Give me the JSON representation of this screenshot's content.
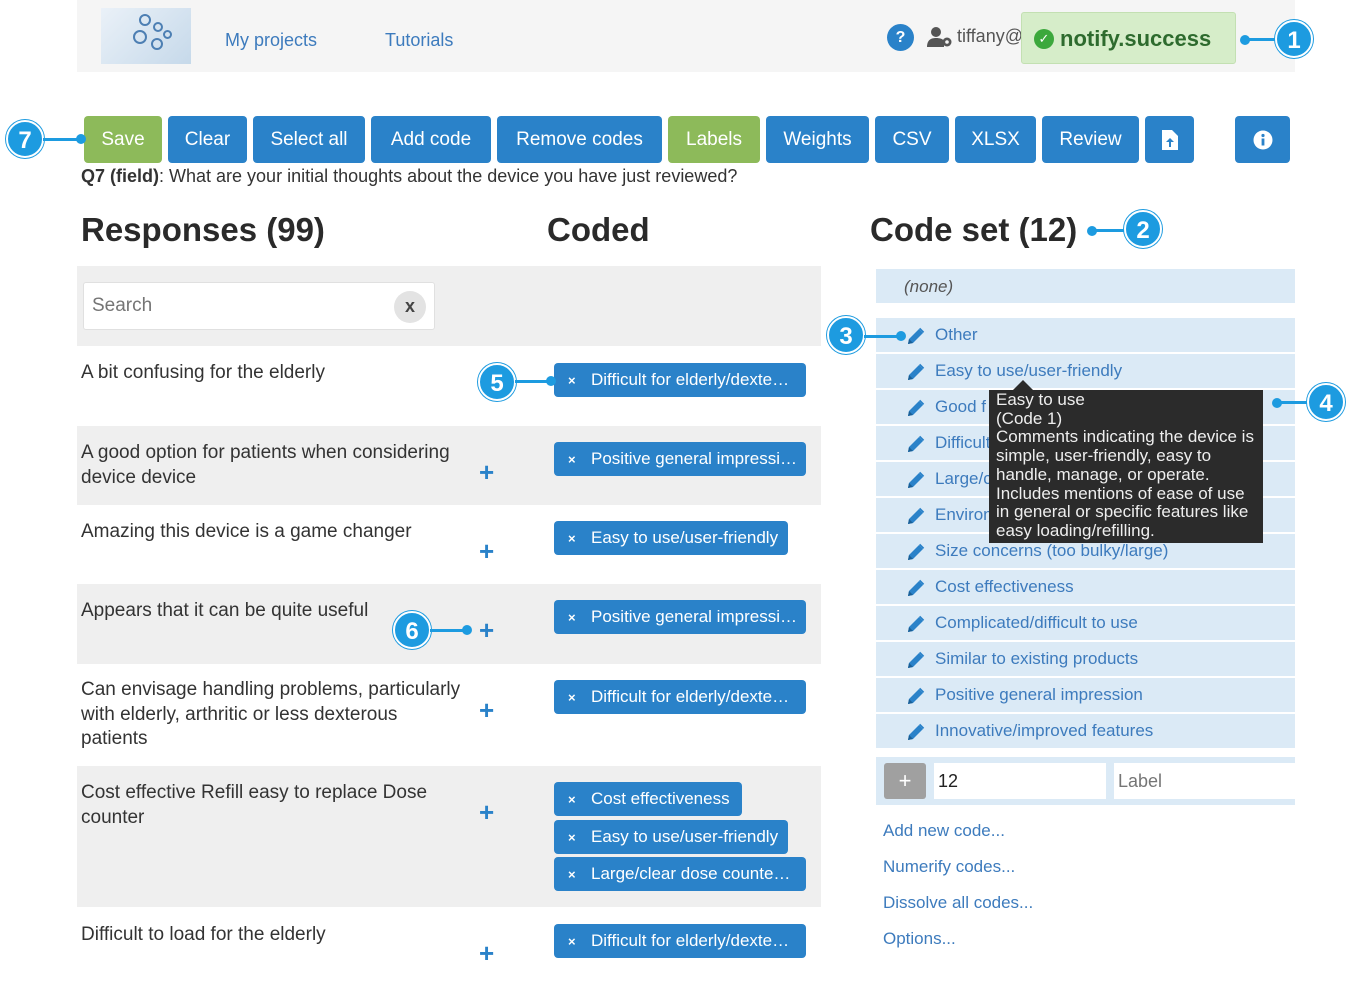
{
  "header": {
    "nav": [
      "My projects",
      "Tutorials"
    ],
    "user": "tiffany@",
    "help": "?",
    "notification": "notify.success"
  },
  "toolbar": {
    "buttons": [
      "Save",
      "Clear",
      "Select all",
      "Add code",
      "Remove codes",
      "Labels",
      "Weights",
      "CSV",
      "XLSX",
      "Review"
    ],
    "export_icon": "file-upload-icon",
    "info_icon": "info-icon"
  },
  "question": {
    "id": "Q7 (field)",
    "text": ": What are your initial thoughts about the device you have just reviewed?"
  },
  "headings": {
    "responses": "Responses (99)",
    "coded": "Coded",
    "codeset": "Code set (12)"
  },
  "search": {
    "placeholder": "Search",
    "clear": "x"
  },
  "responses": [
    {
      "text": "A bit confusing for the elderly",
      "codes": [
        "Difficult for elderly/dexte…"
      ]
    },
    {
      "text": "A good option for patients when considering device device",
      "codes": [
        "Positive general impressi…"
      ]
    },
    {
      "text": "Amazing this device is a game changer",
      "codes": [
        "Easy to use/user-friendly"
      ]
    },
    {
      "text": "Appears that it can be quite useful",
      "codes": [
        "Positive general impressi…"
      ]
    },
    {
      "text": "Can envisage handling problems, particularly with elderly, arthritic or less dexterous patients",
      "codes": [
        "Difficult for elderly/dexte…"
      ]
    },
    {
      "text": "Cost effective Refill easy to replace Dose counter",
      "codes": [
        "Cost effectiveness",
        "Easy to use/user-friendly",
        "Large/clear dose counte…"
      ]
    },
    {
      "text": "Difficult to load for the elderly",
      "codes": [
        "Difficult for elderly/dexte…"
      ]
    }
  ],
  "plus": "+",
  "chip_remove": "×",
  "codeset": {
    "none": "(none)",
    "items": [
      "Other",
      "Easy to use/user-friendly",
      "Good f",
      "Difficult",
      "Large/c",
      "Environ",
      "Size concerns (too bulky/large)",
      "Cost effectiveness",
      "Complicated/difficult to use",
      "Similar to existing products",
      "Positive general impression",
      "Innovative/improved features"
    ],
    "add_plus": "+",
    "add_number": "12",
    "add_label_placeholder": "Label"
  },
  "tooltip": {
    "title": "Easy to use",
    "code": "(Code 1)",
    "description": "Comments indicating the device is simple, user-friendly, easy to handle, manage, or operate. Includes mentions of ease of use in general or specific features like easy loading/refilling."
  },
  "actions": [
    "Add new code...",
    "Numerify codes...",
    "Dissolve all codes...",
    "Options..."
  ],
  "callouts": [
    "1",
    "2",
    "3",
    "4",
    "5",
    "6",
    "7"
  ],
  "colors": {
    "primary": "#2a82c9",
    "green": "#8dba5a",
    "callout": "#1d9be0",
    "code_bg": "#dbeaf6"
  }
}
